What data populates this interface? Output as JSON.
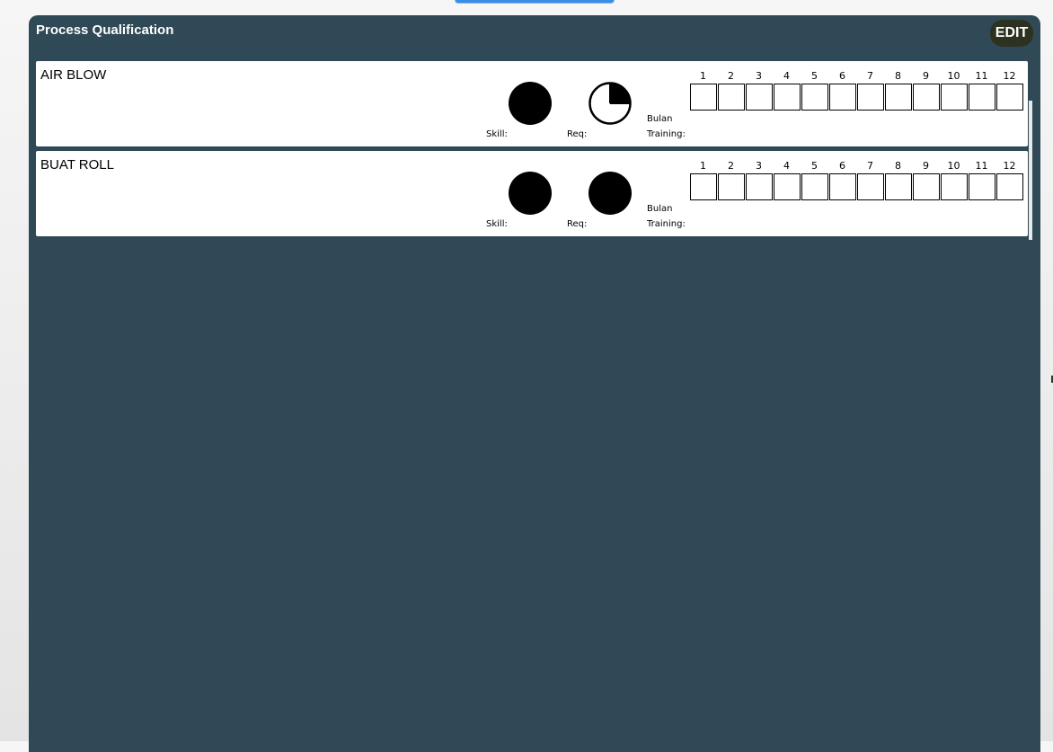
{
  "panel": {
    "title": "Process Qualification",
    "edit_label": "EDIT"
  },
  "labels": {
    "skill": "Skill:",
    "req": "Req:",
    "bulan": "Bulan",
    "training": "Training:"
  },
  "month_numbers": [
    "1",
    "2",
    "3",
    "4",
    "5",
    "6",
    "7",
    "8",
    "9",
    "10",
    "11",
    "12"
  ],
  "rows": [
    {
      "name": "AIR BLOW",
      "skill_level": 1.0,
      "req_level": 0.25,
      "training_months_checked": []
    },
    {
      "name": "BUAT ROLL",
      "skill_level": 1.0,
      "req_level": 1.0,
      "training_months_checked": []
    }
  ]
}
